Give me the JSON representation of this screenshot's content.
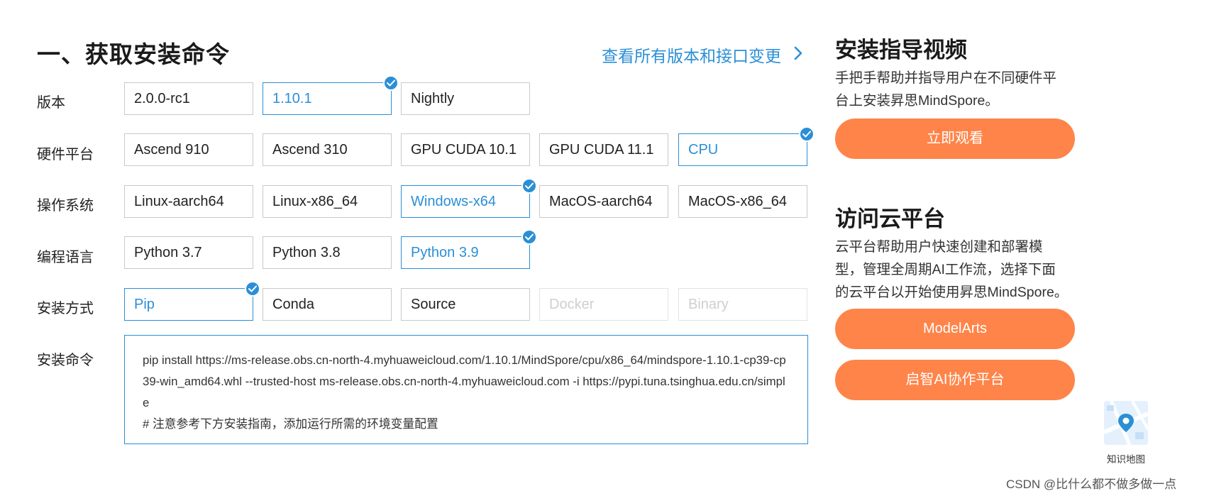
{
  "header": {
    "title": "一、获取安装命令",
    "all_versions_link": "查看所有版本和接口变更"
  },
  "rows": {
    "version": {
      "label": "版本",
      "options": [
        {
          "label": "2.0.0-rc1",
          "state": "normal"
        },
        {
          "label": "1.10.1",
          "state": "selected"
        },
        {
          "label": "Nightly",
          "state": "normal"
        }
      ]
    },
    "hardware": {
      "label": "硬件平台",
      "options": [
        {
          "label": "Ascend 910",
          "state": "normal"
        },
        {
          "label": "Ascend 310",
          "state": "normal"
        },
        {
          "label": "GPU CUDA 10.1",
          "state": "normal"
        },
        {
          "label": "GPU CUDA 11.1",
          "state": "normal"
        },
        {
          "label": "CPU",
          "state": "selected"
        }
      ]
    },
    "os": {
      "label": "操作系统",
      "options": [
        {
          "label": "Linux-aarch64",
          "state": "normal"
        },
        {
          "label": "Linux-x86_64",
          "state": "normal"
        },
        {
          "label": "Windows-x64",
          "state": "selected"
        },
        {
          "label": "MacOS-aarch64",
          "state": "normal"
        },
        {
          "label": "MacOS-x86_64",
          "state": "normal"
        }
      ]
    },
    "language": {
      "label": "编程语言",
      "options": [
        {
          "label": "Python 3.7",
          "state": "normal"
        },
        {
          "label": "Python 3.8",
          "state": "normal"
        },
        {
          "label": "Python 3.9",
          "state": "selected"
        }
      ]
    },
    "method": {
      "label": "安装方式",
      "options": [
        {
          "label": "Pip",
          "state": "selected"
        },
        {
          "label": "Conda",
          "state": "normal"
        },
        {
          "label": "Source",
          "state": "normal"
        },
        {
          "label": "Docker",
          "state": "disabled"
        },
        {
          "label": "Binary",
          "state": "disabled"
        }
      ]
    },
    "command": {
      "label": "安装命令",
      "text": "pip install https://ms-release.obs.cn-north-4.myhuaweicloud.com/1.10.1/MindSpore/cpu/x86_64/mindspore-1.10.1-cp39-cp39-win_amd64.whl --trusted-host ms-release.obs.cn-north-4.myhuaweicloud.com -i https://pypi.tuna.tsinghua.edu.cn/simple",
      "note": "# 注意参考下方安装指南，添加运行所需的环境变量配置"
    }
  },
  "video": {
    "title": "安装指导视频",
    "description": "手把手帮助并指导用户在不同硬件平台上安装昇思MindSpore。",
    "button": "立即观看"
  },
  "cloud": {
    "title": "访问云平台",
    "description": "云平台帮助用户快速创建和部署模型，管理全周期AI工作流，选择下面的云平台以开始使用昇思MindSpore。",
    "button1": "ModelArts",
    "button2": "启智AI协作平台"
  },
  "knowledge_map": {
    "label": "知识地图"
  },
  "watermark": "CSDN @比什么都不做多做一点",
  "colors": {
    "accent": "#2b8fd6",
    "cta": "#ff8449",
    "border": "#c9c9c9",
    "disabled": "#cfcfcf"
  }
}
